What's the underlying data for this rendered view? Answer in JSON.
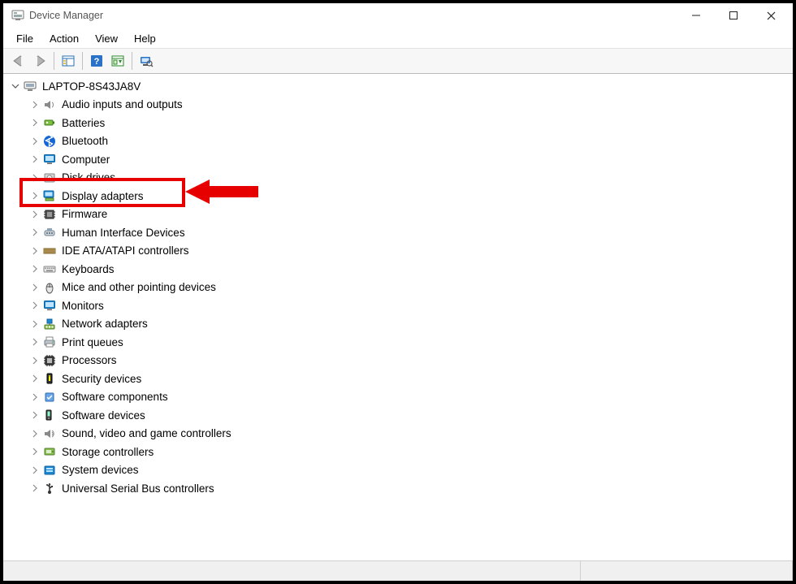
{
  "window": {
    "title": "Device Manager"
  },
  "menubar": {
    "items": [
      "File",
      "Action",
      "View",
      "Help"
    ]
  },
  "toolbar": {
    "buttons": [
      "back",
      "forward",
      "show-hidden",
      "help",
      "update",
      "scan"
    ]
  },
  "tree": {
    "root": {
      "label": "LAPTOP-8S43JA8V",
      "expanded": true,
      "icon": "computer-root"
    },
    "children": [
      {
        "label": "Audio inputs and outputs",
        "icon": "speaker"
      },
      {
        "label": "Batteries",
        "icon": "battery"
      },
      {
        "label": "Bluetooth",
        "icon": "bluetooth"
      },
      {
        "label": "Computer",
        "icon": "monitor"
      },
      {
        "label": "Disk drives",
        "icon": "disk"
      },
      {
        "label": "Display adapters",
        "icon": "display-adapter",
        "highlighted": true
      },
      {
        "label": "Firmware",
        "icon": "chip"
      },
      {
        "label": "Human Interface Devices",
        "icon": "hid"
      },
      {
        "label": "IDE ATA/ATAPI controllers",
        "icon": "ide"
      },
      {
        "label": "Keyboards",
        "icon": "keyboard"
      },
      {
        "label": "Mice and other pointing devices",
        "icon": "mouse"
      },
      {
        "label": "Monitors",
        "icon": "monitor"
      },
      {
        "label": "Network adapters",
        "icon": "network"
      },
      {
        "label": "Print queues",
        "icon": "printer"
      },
      {
        "label": "Processors",
        "icon": "cpu"
      },
      {
        "label": "Security devices",
        "icon": "security"
      },
      {
        "label": "Software components",
        "icon": "software-component"
      },
      {
        "label": "Software devices",
        "icon": "software-device"
      },
      {
        "label": "Sound, video and game controllers",
        "icon": "sound"
      },
      {
        "label": "Storage controllers",
        "icon": "storage"
      },
      {
        "label": "System devices",
        "icon": "system"
      },
      {
        "label": "Universal Serial Bus controllers",
        "icon": "usb"
      }
    ]
  }
}
